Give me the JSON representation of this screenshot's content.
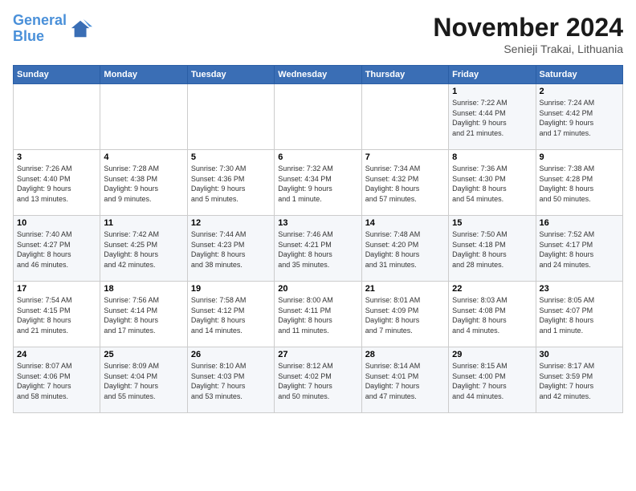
{
  "logo": {
    "text_general": "General",
    "text_blue": "Blue"
  },
  "header": {
    "month": "November 2024",
    "location": "Senieji Trakai, Lithuania"
  },
  "weekdays": [
    "Sunday",
    "Monday",
    "Tuesday",
    "Wednesday",
    "Thursday",
    "Friday",
    "Saturday"
  ],
  "weeks": [
    [
      {
        "day": "",
        "info": ""
      },
      {
        "day": "",
        "info": ""
      },
      {
        "day": "",
        "info": ""
      },
      {
        "day": "",
        "info": ""
      },
      {
        "day": "",
        "info": ""
      },
      {
        "day": "1",
        "info": "Sunrise: 7:22 AM\nSunset: 4:44 PM\nDaylight: 9 hours\nand 21 minutes."
      },
      {
        "day": "2",
        "info": "Sunrise: 7:24 AM\nSunset: 4:42 PM\nDaylight: 9 hours\nand 17 minutes."
      }
    ],
    [
      {
        "day": "3",
        "info": "Sunrise: 7:26 AM\nSunset: 4:40 PM\nDaylight: 9 hours\nand 13 minutes."
      },
      {
        "day": "4",
        "info": "Sunrise: 7:28 AM\nSunset: 4:38 PM\nDaylight: 9 hours\nand 9 minutes."
      },
      {
        "day": "5",
        "info": "Sunrise: 7:30 AM\nSunset: 4:36 PM\nDaylight: 9 hours\nand 5 minutes."
      },
      {
        "day": "6",
        "info": "Sunrise: 7:32 AM\nSunset: 4:34 PM\nDaylight: 9 hours\nand 1 minute."
      },
      {
        "day": "7",
        "info": "Sunrise: 7:34 AM\nSunset: 4:32 PM\nDaylight: 8 hours\nand 57 minutes."
      },
      {
        "day": "8",
        "info": "Sunrise: 7:36 AM\nSunset: 4:30 PM\nDaylight: 8 hours\nand 54 minutes."
      },
      {
        "day": "9",
        "info": "Sunrise: 7:38 AM\nSunset: 4:28 PM\nDaylight: 8 hours\nand 50 minutes."
      }
    ],
    [
      {
        "day": "10",
        "info": "Sunrise: 7:40 AM\nSunset: 4:27 PM\nDaylight: 8 hours\nand 46 minutes."
      },
      {
        "day": "11",
        "info": "Sunrise: 7:42 AM\nSunset: 4:25 PM\nDaylight: 8 hours\nand 42 minutes."
      },
      {
        "day": "12",
        "info": "Sunrise: 7:44 AM\nSunset: 4:23 PM\nDaylight: 8 hours\nand 38 minutes."
      },
      {
        "day": "13",
        "info": "Sunrise: 7:46 AM\nSunset: 4:21 PM\nDaylight: 8 hours\nand 35 minutes."
      },
      {
        "day": "14",
        "info": "Sunrise: 7:48 AM\nSunset: 4:20 PM\nDaylight: 8 hours\nand 31 minutes."
      },
      {
        "day": "15",
        "info": "Sunrise: 7:50 AM\nSunset: 4:18 PM\nDaylight: 8 hours\nand 28 minutes."
      },
      {
        "day": "16",
        "info": "Sunrise: 7:52 AM\nSunset: 4:17 PM\nDaylight: 8 hours\nand 24 minutes."
      }
    ],
    [
      {
        "day": "17",
        "info": "Sunrise: 7:54 AM\nSunset: 4:15 PM\nDaylight: 8 hours\nand 21 minutes."
      },
      {
        "day": "18",
        "info": "Sunrise: 7:56 AM\nSunset: 4:14 PM\nDaylight: 8 hours\nand 17 minutes."
      },
      {
        "day": "19",
        "info": "Sunrise: 7:58 AM\nSunset: 4:12 PM\nDaylight: 8 hours\nand 14 minutes."
      },
      {
        "day": "20",
        "info": "Sunrise: 8:00 AM\nSunset: 4:11 PM\nDaylight: 8 hours\nand 11 minutes."
      },
      {
        "day": "21",
        "info": "Sunrise: 8:01 AM\nSunset: 4:09 PM\nDaylight: 8 hours\nand 7 minutes."
      },
      {
        "day": "22",
        "info": "Sunrise: 8:03 AM\nSunset: 4:08 PM\nDaylight: 8 hours\nand 4 minutes."
      },
      {
        "day": "23",
        "info": "Sunrise: 8:05 AM\nSunset: 4:07 PM\nDaylight: 8 hours\nand 1 minute."
      }
    ],
    [
      {
        "day": "24",
        "info": "Sunrise: 8:07 AM\nSunset: 4:06 PM\nDaylight: 7 hours\nand 58 minutes."
      },
      {
        "day": "25",
        "info": "Sunrise: 8:09 AM\nSunset: 4:04 PM\nDaylight: 7 hours\nand 55 minutes."
      },
      {
        "day": "26",
        "info": "Sunrise: 8:10 AM\nSunset: 4:03 PM\nDaylight: 7 hours\nand 53 minutes."
      },
      {
        "day": "27",
        "info": "Sunrise: 8:12 AM\nSunset: 4:02 PM\nDaylight: 7 hours\nand 50 minutes."
      },
      {
        "day": "28",
        "info": "Sunrise: 8:14 AM\nSunset: 4:01 PM\nDaylight: 7 hours\nand 47 minutes."
      },
      {
        "day": "29",
        "info": "Sunrise: 8:15 AM\nSunset: 4:00 PM\nDaylight: 7 hours\nand 44 minutes."
      },
      {
        "day": "30",
        "info": "Sunrise: 8:17 AM\nSunset: 3:59 PM\nDaylight: 7 hours\nand 42 minutes."
      }
    ]
  ]
}
